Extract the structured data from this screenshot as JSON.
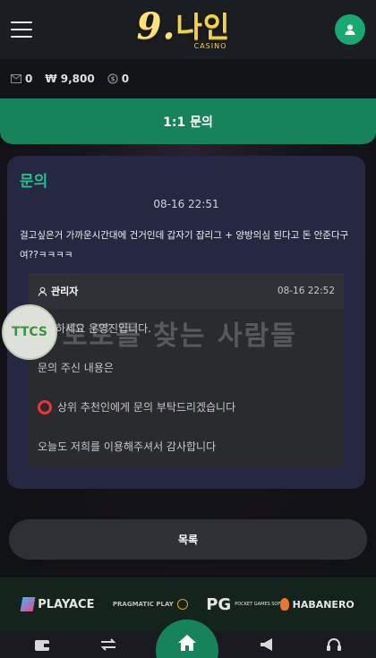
{
  "header": {
    "logo_main": "9.나인",
    "logo_nine": "9.",
    "logo_hangul": "나인",
    "logo_sub": "CASINO"
  },
  "balance": {
    "messages": "0",
    "money": "₩ 9,800",
    "points": "0"
  },
  "page": {
    "title": "1:1 문의"
  },
  "inquiry": {
    "heading": "문의",
    "date": "08-16 22:51",
    "body": "걸고싶은거 가까운시간대에 건거인데 갑자기 잡리그 + 양방의심 된다고 돈 안준다구여??ㅋㅋㅋㅋ"
  },
  "reply": {
    "author": "관리자",
    "date": "08-16 22:52",
    "lines": [
      "하세요 운영진입니다.",
      "문의 주신 내용은",
      "상위 추천인에게 문의 부탁드리겠습니다",
      "오늘도 저희를 이용해주셔서 감사합니다"
    ]
  },
  "watermark": {
    "logo_text": "TTCS",
    "text": "토토를 찾는 사람들"
  },
  "actions": {
    "list_label": "목록"
  },
  "providers": [
    {
      "name": "PLAYACE"
    },
    {
      "name": "PRAGMATIC PLAY"
    },
    {
      "name": "PG",
      "sub": "POCKET GAMES SOFT"
    },
    {
      "name": "HABANERO"
    }
  ],
  "colors": {
    "accent": "#17835a",
    "heading": "#27c08a",
    "card": "#262842",
    "alert_red": "#e33333"
  }
}
